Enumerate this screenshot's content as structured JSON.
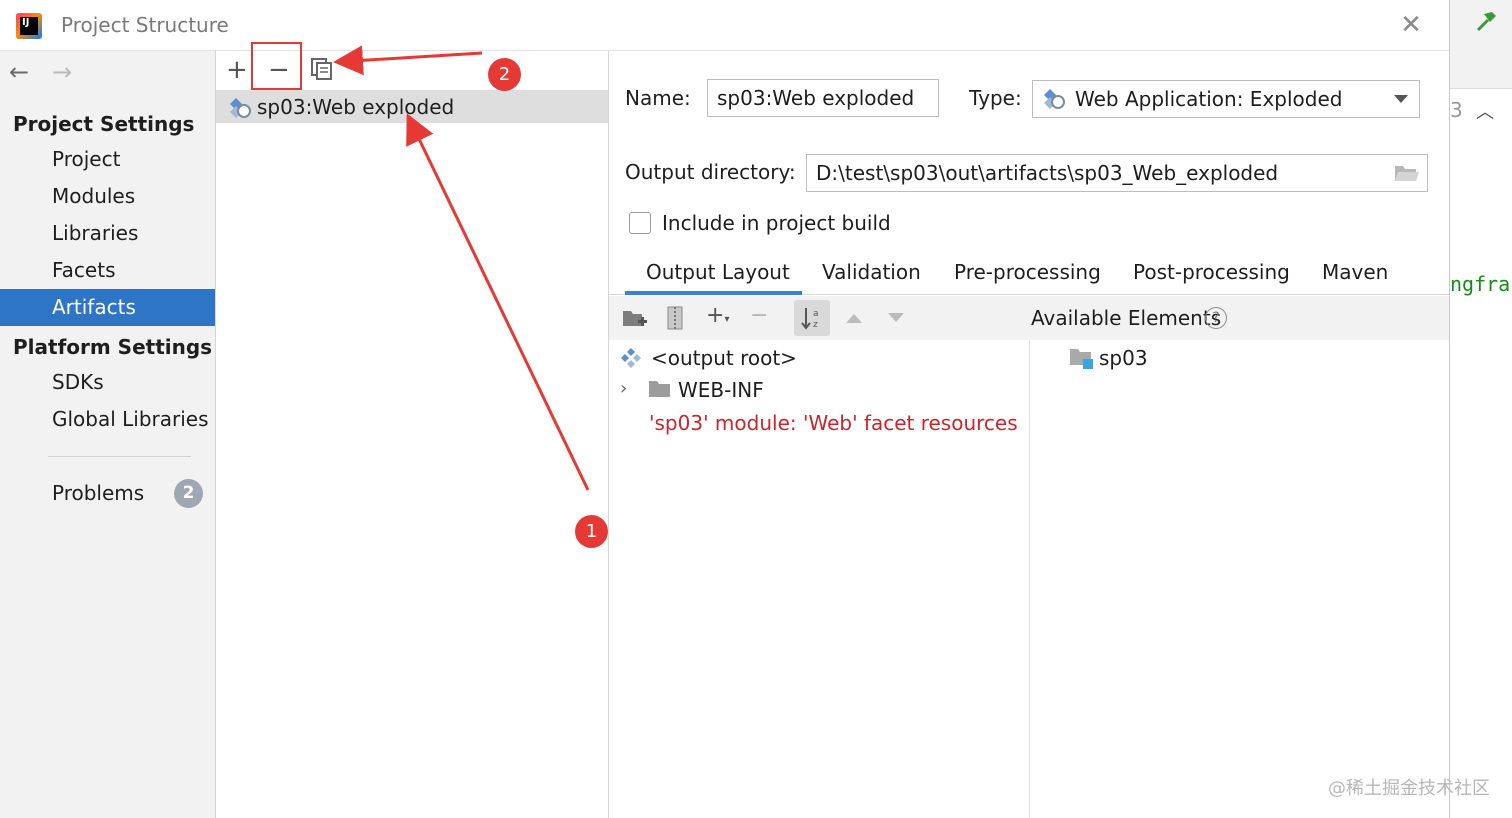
{
  "window": {
    "title": "Project Structure",
    "close_glyph": "✕",
    "logo_text": "IJ"
  },
  "nav": {
    "back_glyph": "←",
    "forward_glyph": "→"
  },
  "sidebar": {
    "project_settings_header": "Project Settings",
    "project_items": [
      "Project",
      "Modules",
      "Libraries",
      "Facets",
      "Artifacts"
    ],
    "selected_item": "Artifacts",
    "platform_settings_header": "Platform Settings",
    "platform_items": [
      "SDKs",
      "Global Libraries"
    ],
    "problems_label": "Problems",
    "problems_count": "2"
  },
  "artifacts_list": {
    "toolbar": {
      "add_glyph": "+",
      "remove_glyph": "−"
    },
    "items": [
      "sp03:Web exploded"
    ],
    "selected_index": 0
  },
  "annotations": {
    "badge_1": "1",
    "badge_2": "2",
    "color": "#e53935"
  },
  "detail": {
    "name_label": "Name:",
    "name_value": "sp03:Web exploded",
    "type_label": "Type:",
    "type_value": "Web Application: Exploded",
    "output_dir_label": "Output directory:",
    "output_dir_value": "D:\\test\\sp03\\out\\artifacts\\sp03_Web_exploded",
    "include_build_label": "Include in project build",
    "include_build_checked": false,
    "tabs": [
      "Output Layout",
      "Validation",
      "Pre-processing",
      "Post-processing",
      "Maven"
    ],
    "active_tab": "Output Layout",
    "available_elements_label": "Available Elements",
    "help_glyph": "?",
    "layout_tree": {
      "root": "<output root>",
      "webinf": "WEB-INF",
      "facet_resources": "'sp03' module: 'Web' facet resources"
    },
    "available_tree": [
      "sp03"
    ]
  },
  "ide_background": {
    "line_number": "3",
    "code_fragment": "ngfra"
  },
  "watermark": "@稀土掘金技术社区",
  "colors": {
    "accent": "#2f75c6",
    "error_text": "#c8252c",
    "annotation_red": "#e53935",
    "tab_underline": "#3f7ed6"
  }
}
